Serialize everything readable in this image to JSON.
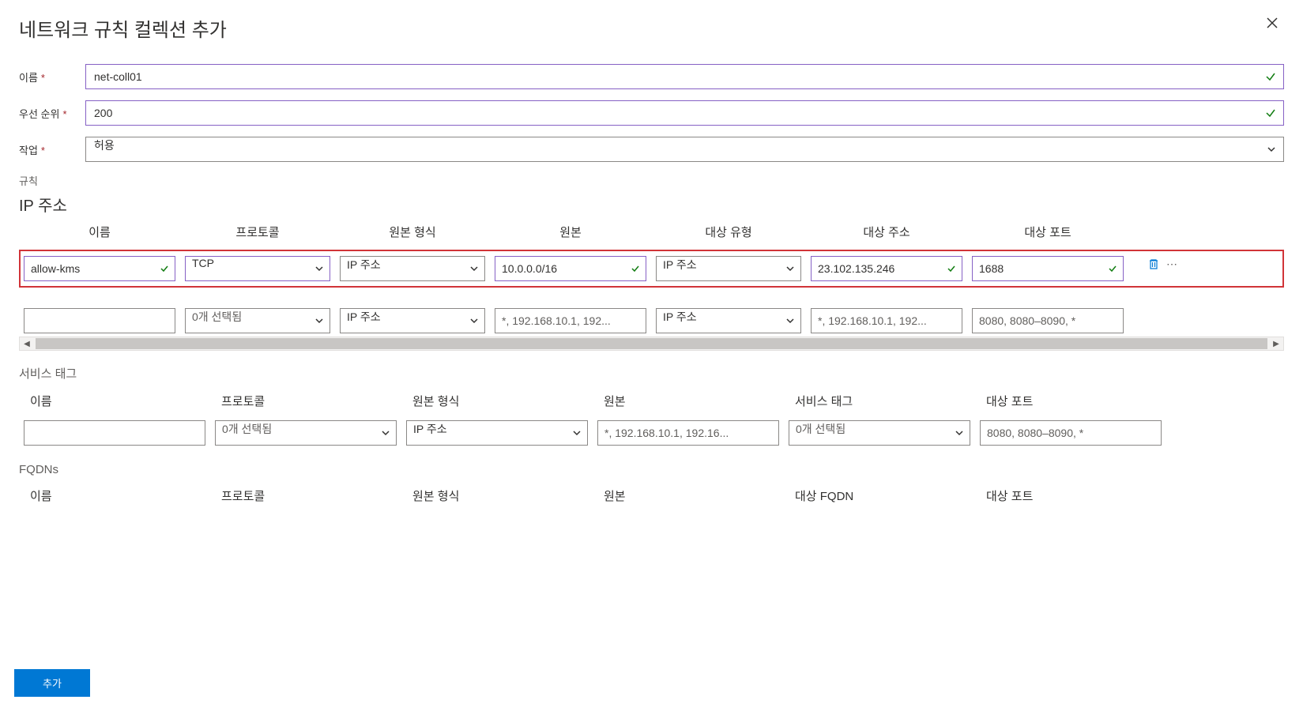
{
  "header": {
    "title": "네트워크 규칙 컬렉션 추가"
  },
  "form": {
    "name": {
      "label": "이름",
      "value": "net-coll01"
    },
    "priority": {
      "label": "우선 순위",
      "value": "200"
    },
    "action": {
      "label": "작업",
      "value": "허용"
    }
  },
  "rules_label": "규칙",
  "ip_section": {
    "title": "IP 주소",
    "columns": {
      "name": "이름",
      "protocol": "프로토콜",
      "source_type": "원본 형식",
      "source": "원본",
      "dest_type": "대상 유형",
      "dest_addr": "대상 주소",
      "dest_port": "대상 포트"
    },
    "rows": [
      {
        "highlighted": true,
        "name": "allow-kms",
        "protocol": "TCP",
        "source_type": "IP 주소",
        "source": "10.0.0.0/16",
        "dest_type": "IP 주소",
        "dest_addr": "23.102.135.246",
        "dest_port": "1688"
      },
      {
        "highlighted": false,
        "name": "",
        "protocol_placeholder": "0개 선택됨",
        "source_type": "IP 주소",
        "source_placeholder": "*, 192.168.10.1, 192...",
        "dest_type": "IP 주소",
        "dest_addr_placeholder": "*, 192.168.10.1, 192...",
        "dest_port_placeholder": "8080, 8080–8090, *"
      }
    ]
  },
  "service_tag_section": {
    "title": "서비스 태그",
    "columns": {
      "name": "이름",
      "protocol": "프로토콜",
      "source_type": "원본 형식",
      "source": "원본",
      "service_tag": "서비스 태그",
      "dest_port": "대상 포트"
    },
    "row": {
      "protocol_placeholder": "0개 선택됨",
      "source_type": "IP 주소",
      "source_placeholder": "*, 192.168.10.1, 192.16...",
      "service_tag_placeholder": "0개 선택됨",
      "dest_port_placeholder": "8080, 8080–8090, *"
    }
  },
  "fqdn_section": {
    "title": "FQDNs",
    "columns": {
      "name": "이름",
      "protocol": "프로토콜",
      "source_type": "원본 형식",
      "source": "원본",
      "dest_fqdn": "대상 FQDN",
      "dest_port": "대상 포트"
    }
  },
  "footer": {
    "add_label": "추가"
  }
}
